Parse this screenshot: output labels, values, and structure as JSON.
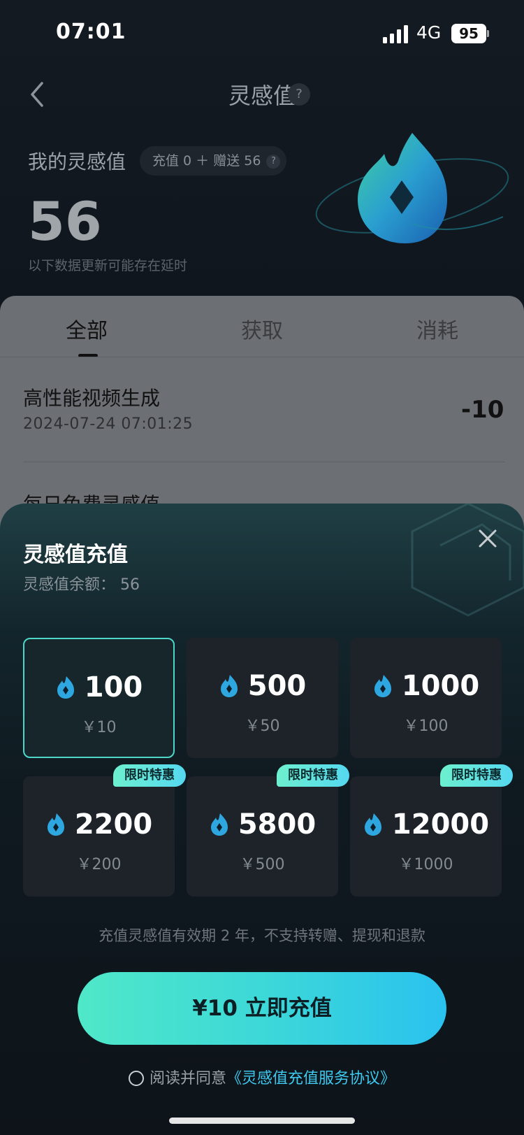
{
  "status_bar": {
    "time": "07:01",
    "network": "4G",
    "battery": "95"
  },
  "header": {
    "title": "灵感值",
    "help": "?"
  },
  "summary": {
    "label": "我的灵感值",
    "pill_text": "充值 0 ＋ 赠送 56",
    "pill_help": "?",
    "value": "56",
    "note": "以下数据更新可能存在延时"
  },
  "tabs": [
    {
      "label": "全部",
      "active": true
    },
    {
      "label": "获取",
      "active": false
    },
    {
      "label": "消耗",
      "active": false
    }
  ],
  "records": [
    {
      "title": "高性能视频生成",
      "time": "2024-07-24 07:01:25",
      "value": "-10"
    },
    {
      "title": "每日免费灵感值"
    }
  ],
  "sheet": {
    "title": "灵感值充值",
    "balance": "灵感值余额：  56",
    "packages": [
      {
        "amount": "100",
        "price": "￥10",
        "selected": true
      },
      {
        "amount": "500",
        "price": "￥50"
      },
      {
        "amount": "1000",
        "price": "￥100"
      },
      {
        "amount": "2200",
        "price": "￥200",
        "badge": "限时特惠"
      },
      {
        "amount": "5800",
        "price": "￥500",
        "badge": "限时特惠"
      },
      {
        "amount": "12000",
        "price": "￥1000",
        "badge": "限时特惠"
      }
    ],
    "note": "充值灵感值有效期 2 年，不支持转赠、提现和退款",
    "cta": "¥10 立即充值",
    "agree_prefix": "阅读并同意",
    "agree_link": "《灵感值充值服务协议》"
  },
  "colors": {
    "accent": "#3ec9ef",
    "selected_border": "#4dd7c9",
    "cta_start": "#4fe8c8",
    "cta_end": "#2ac2ef"
  }
}
